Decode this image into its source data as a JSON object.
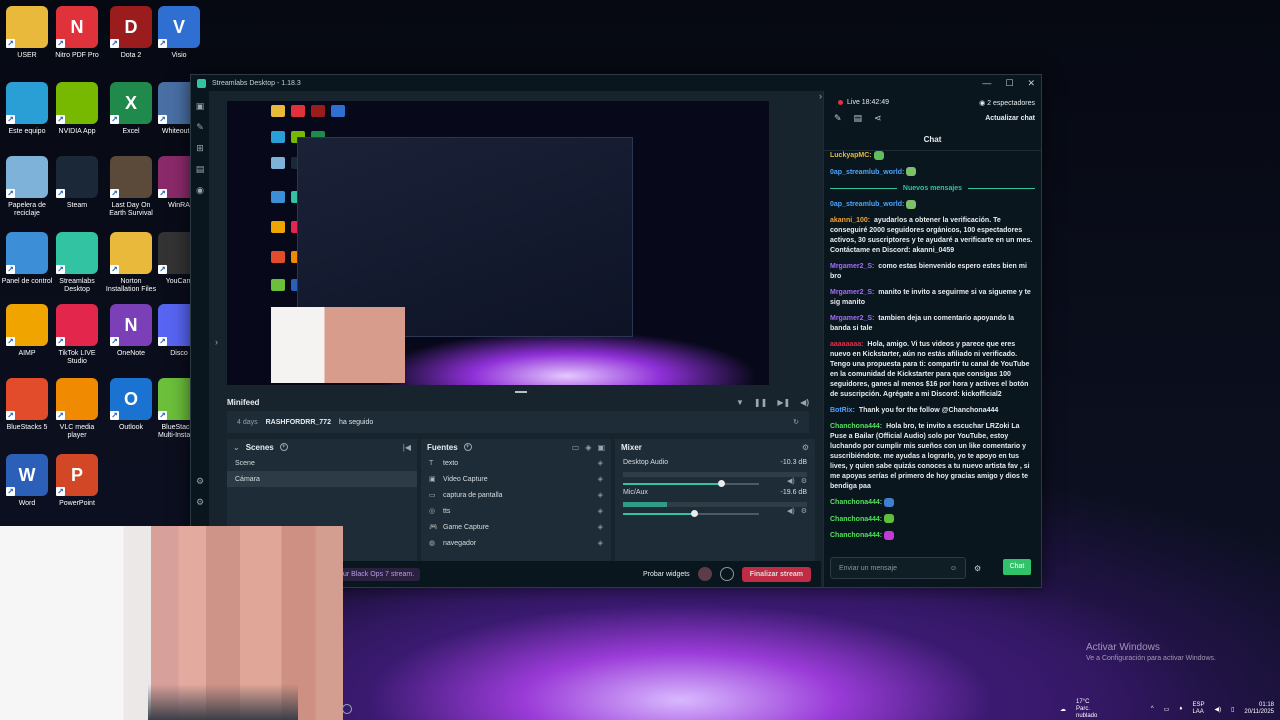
{
  "desktop": {
    "icons": [
      {
        "label": "USER",
        "color": "#e8b93a",
        "glyph": ""
      },
      {
        "label": "Nitro PDF Pro",
        "color": "#e0323b",
        "glyph": "N"
      },
      {
        "label": "Dota 2",
        "color": "#9b1c1c",
        "glyph": "D"
      },
      {
        "label": "Visio",
        "color": "#2f6fd1",
        "glyph": "V"
      },
      {
        "label": "Este equipo",
        "color": "#2a9fd6",
        "glyph": ""
      },
      {
        "label": "NVIDIA App",
        "color": "#76b900",
        "glyph": ""
      },
      {
        "label": "Excel",
        "color": "#1f8a4c",
        "glyph": "X"
      },
      {
        "label": "Whiteout S",
        "color": "#4a6fa5",
        "glyph": ""
      },
      {
        "label": "Papelera de reciclaje",
        "color": "#7fb2d8",
        "glyph": ""
      },
      {
        "label": "Steam",
        "color": "#1b2838",
        "glyph": ""
      },
      {
        "label": "Last Day On Earth Survival",
        "color": "#5b4a3a",
        "glyph": ""
      },
      {
        "label": "WinRA",
        "color": "#8b2a6a",
        "glyph": ""
      },
      {
        "label": "Panel de control",
        "color": "#3c8fd6",
        "glyph": ""
      },
      {
        "label": "Streamlabs Desktop",
        "color": "#31c3a2",
        "glyph": ""
      },
      {
        "label": "Norton Installation Files",
        "color": "#e8b93a",
        "glyph": ""
      },
      {
        "label": "YouCam",
        "color": "#333",
        "glyph": ""
      },
      {
        "label": "AIMP",
        "color": "#f0a400",
        "glyph": ""
      },
      {
        "label": "TikTok LIVE Studio",
        "color": "#e3264b",
        "glyph": ""
      },
      {
        "label": "OneNote",
        "color": "#7b3fb8",
        "glyph": "N"
      },
      {
        "label": "Disco",
        "color": "#5865f2",
        "glyph": ""
      },
      {
        "label": "BlueStacks 5",
        "color": "#e34c2a",
        "glyph": ""
      },
      {
        "label": "VLC media player",
        "color": "#f08a00",
        "glyph": ""
      },
      {
        "label": "Outlook",
        "color": "#1a73d0",
        "glyph": "O"
      },
      {
        "label": "BlueStacks Multi-Instan...",
        "color": "#6bbf3a",
        "glyph": ""
      },
      {
        "label": "Word",
        "color": "#2b5fb8",
        "glyph": "W"
      },
      {
        "label": "PowerPoint",
        "color": "#d24726",
        "glyph": "P"
      }
    ]
  },
  "window": {
    "title": "Streamlabs Desktop - 1.18.3",
    "minimize": "—",
    "maximize": "☐",
    "close": "✕"
  },
  "minifeed": {
    "title": "Minifeed",
    "ago": "4 days",
    "user": "RASHFORDRR_772",
    "action": "ha seguido"
  },
  "scenes": {
    "title": "Scenes",
    "items": [
      "Scene",
      "Cámara"
    ],
    "selected": 1
  },
  "sources": {
    "title": "Fuentes",
    "items": [
      {
        "icon": "T",
        "label": "texto"
      },
      {
        "icon": "▣",
        "label": "Video Capture"
      },
      {
        "icon": "▭",
        "label": "captura de pantalla"
      },
      {
        "icon": "◎",
        "label": "tts"
      },
      {
        "icon": "🎮",
        "label": "Game Capture"
      },
      {
        "icon": "◍",
        "label": "navegador"
      }
    ]
  },
  "mixer": {
    "title": "Mixer",
    "channels": [
      {
        "name": "Desktop Audio",
        "db": "-10.3 dB",
        "level": 0,
        "volume": 0.72
      },
      {
        "name": "Mic/Aux",
        "db": "-19.6 dB",
        "level": 0.24,
        "volume": 0.52
      }
    ]
  },
  "bottombar": {
    "prompt": "ur Black Ops 7 stream.",
    "test_widgets": "Probar widgets",
    "end_stream": "Finalizar stream"
  },
  "chat": {
    "live_label": "Live 18:42:49",
    "viewers": "2 espectadores",
    "refresh": "Actualizar chat",
    "title": "Chat",
    "new_messages": "Nuevos mensajes",
    "input_placeholder": "Enviar un mensaje",
    "send": "Chat",
    "messages": [
      {
        "user": "LuckyapMC:",
        "color": "#e8b93a",
        "text": "",
        "emote": "#5fbf5f"
      },
      {
        "user": "0ap_streamlub_world:",
        "color": "#4fa3ff",
        "text": "",
        "emote": "#7cc06a"
      },
      {
        "user": "0ap_streamlub_world:",
        "color": "#4fa3ff",
        "text": "",
        "emote": "#7cc06a"
      },
      {
        "user": "akanni_100:",
        "color": "#f2a33a",
        "text": "ayudarlos a obtener la verificación. Te conseguiré 2000 seguidores orgánicos, 100 espectadores activos, 30 suscriptores y te ayudaré a verificarte en un mes. Contáctame en Discord: akanni_0459",
        "emote": ""
      },
      {
        "user": "Mrgamer2_S:",
        "color": "#a66bff",
        "text": "como estas bienvenido espero estes bien mi bro",
        "emote": ""
      },
      {
        "user": "Mrgamer2_S:",
        "color": "#a66bff",
        "text": "manito te invito a seguirme si va sigueme y te sig manito",
        "emote": ""
      },
      {
        "user": "Mrgamer2_S:",
        "color": "#a66bff",
        "text": "tambien deja un comentario apoyando la banda si tale",
        "emote": ""
      },
      {
        "user": "aaaaaaaa:",
        "color": "#e0314b",
        "text": "Hola, amigo. Vi tus videos y parece que eres nuevo en Kickstarter, aún no estás afiliado ni verificado. Tengo una propuesta para ti: compartir tu canal de YouTube en la comunidad de Kickstarter para que consigas 100 seguidores, ganes al menos $16 por hora y actives el botón de suscripción. Agrégate a mi Discord: kickofficial2",
        "emote": ""
      },
      {
        "user": "BotRix:",
        "color": "#4fa3ff",
        "text": "Thank you for the follow @Chanchona444",
        "emote": ""
      },
      {
        "user": "Chanchona444:",
        "color": "#53e35b",
        "text": "Hola bro, te invito a escuchar LRZoki La Puse a Bailar (Official Audio) solo por YouTube, estoy luchando por cumplir mis sueños con un like comentario y suscribiéndote. me ayudas a lograrlo, yo te apoyo en tus lives, y quien sabe quizás conoces a tu nuevo artista fav , si me apoyas serías el primero de hoy gracias amigo y dios te bendiga paa",
        "emote": ""
      },
      {
        "user": "Chanchona444:",
        "color": "#53e35b",
        "text": "",
        "emote": "#3f7fd0"
      },
      {
        "user": "Chanchona444:",
        "color": "#53e35b",
        "text": "",
        "emote": "#5fbf3a"
      },
      {
        "user": "Chanchona444:",
        "color": "#53e35b",
        "text": "",
        "emote": "#c33ad6"
      }
    ]
  },
  "activation": {
    "title": "Activar Windows",
    "subtitle": "Ve a Configuración para activar Windows."
  },
  "tray": {
    "temp": "17°C",
    "weather": "Parc. nublado",
    "lang": "ESP",
    "region": "LAA",
    "time": "01:18",
    "date": "20/11/2025"
  }
}
